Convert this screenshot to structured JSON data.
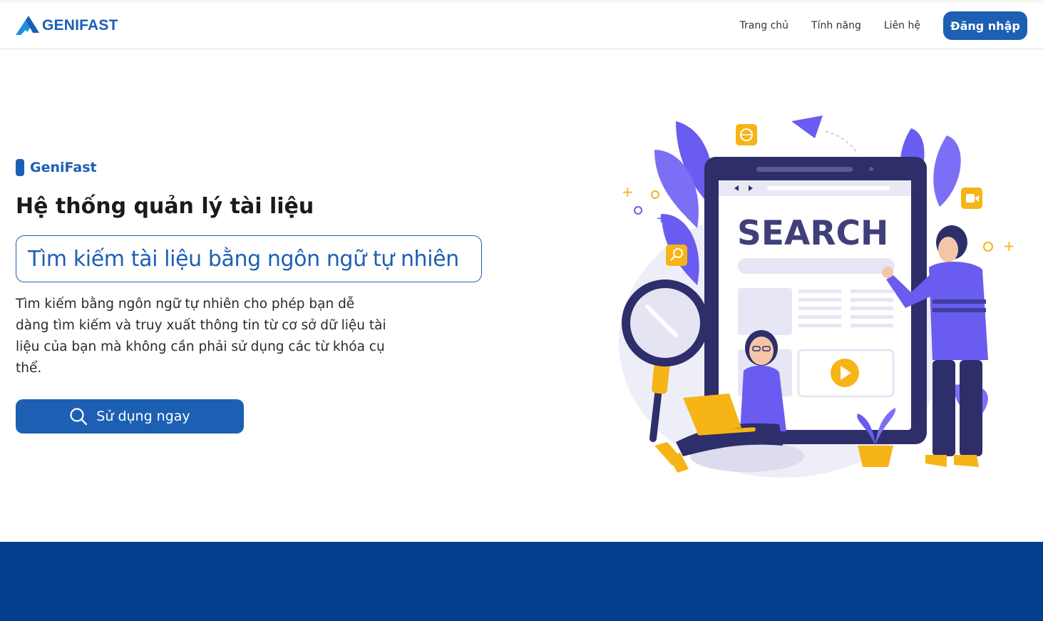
{
  "header": {
    "brand_name": "GENIFAST",
    "nav": [
      "Trang chủ",
      "Tính năng",
      "Liên hệ"
    ],
    "login_label": "Đăng nhập"
  },
  "hero": {
    "eyebrow": "GeniFast",
    "headline": "Hệ thống quản lý tài liệu",
    "highlight": "Tìm kiếm tài liệu bằng ngôn ngữ tự nhiên",
    "description": "Tìm kiếm bằng ngôn ngữ tự nhiên cho phép bạn dễ dàng tìm kiếm và truy xuất thông tin từ cơ sở dữ liệu tài liệu của bạn mà không cần phải sử dụng các từ khóa cụ thể.",
    "cta_label": "Sử dụng ngay",
    "cta_icon": "search-icon"
  },
  "illustration": {
    "screen_word": "SEARCH"
  },
  "colors": {
    "primary": "#1d5fb3",
    "footer": "#043f8e",
    "illustration_purple": "#6a5cf0",
    "illustration_navy": "#2e2e6b",
    "illustration_orange": "#f7b417"
  }
}
